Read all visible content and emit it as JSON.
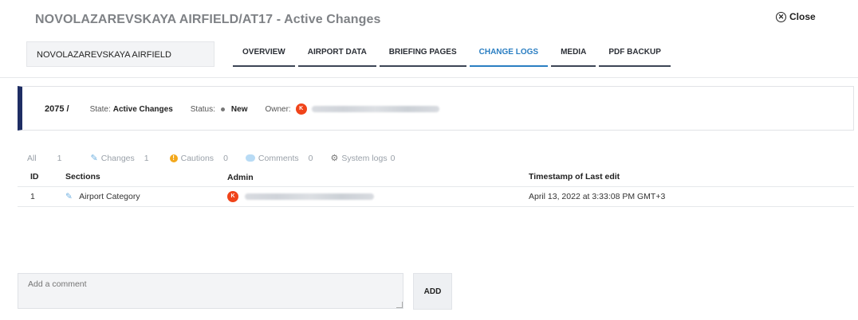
{
  "header": {
    "title": "NOVOLAZAREVSKAYA AIRFIELD/AT17 - Active Changes",
    "close_label": "Close",
    "airfield_name": "NOVOLAZAREVSKAYA AIRFIELD"
  },
  "tabs": [
    {
      "label": "OVERVIEW",
      "active": false
    },
    {
      "label": "AIRPORT DATA",
      "active": false
    },
    {
      "label": "BRIEFING PAGES",
      "active": false
    },
    {
      "label": "CHANGE LOGS",
      "active": true
    },
    {
      "label": "MEDIA",
      "active": false
    },
    {
      "label": "PDF BACKUP",
      "active": false
    }
  ],
  "info": {
    "ref": "2075 /",
    "state_label": "State:",
    "state_value": "Active Changes",
    "status_label": "Status:",
    "status_value": "New",
    "owner_label": "Owner:",
    "owner_avatar": "K"
  },
  "filters": {
    "all_label": "All",
    "all_count": "1",
    "changes_label": "Changes",
    "changes_count": "1",
    "cautions_label": "Cautions",
    "cautions_count": "0",
    "comments_label": "Comments",
    "comments_count": "0",
    "syslogs_label": "System logs",
    "syslogs_count": "0"
  },
  "table": {
    "headers": {
      "id": "ID",
      "sections": "Sections",
      "admin": "Admin",
      "timestamp": "Timestamp of Last edit"
    },
    "rows": [
      {
        "id": "1",
        "section": "Airport Category",
        "admin_avatar": "K",
        "timestamp": "April 13, 2022 at 3:33:08 PM GMT+3"
      }
    ]
  },
  "comment": {
    "placeholder": "Add a comment",
    "add_label": "ADD"
  },
  "colors": {
    "accent": "#2a7ec2",
    "avatar": "#f0441a",
    "info_bar_stripe": "#1e2d63",
    "caution": "#f3a81c"
  }
}
